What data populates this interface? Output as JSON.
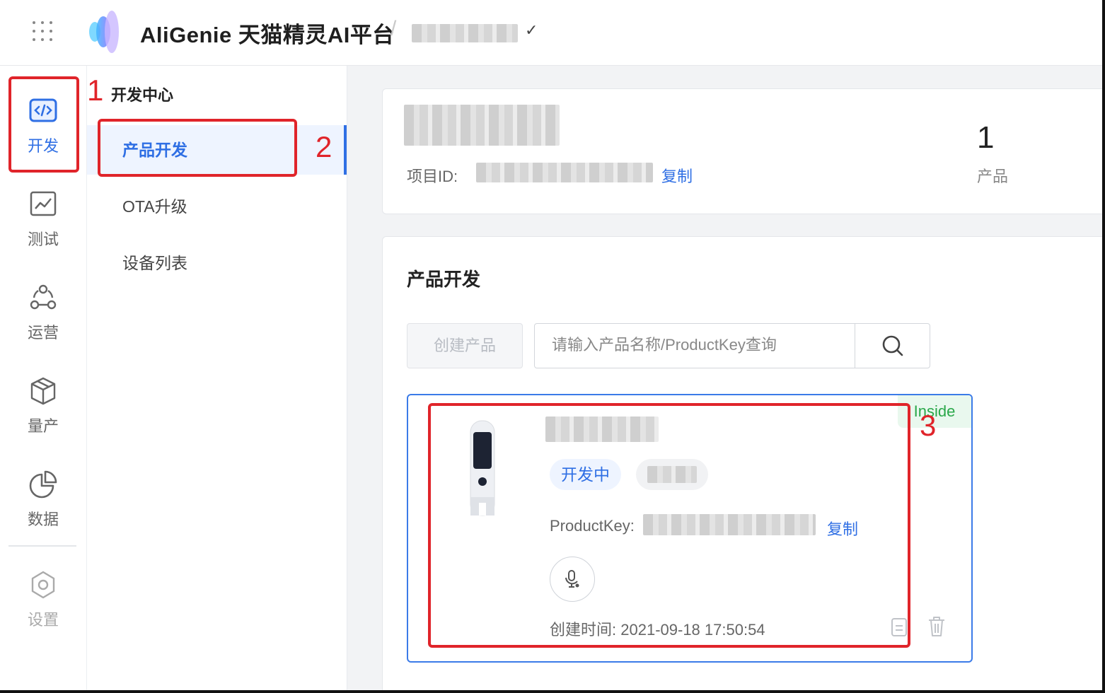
{
  "header": {
    "brand": "AliGenie 天猫精灵AI平台",
    "separator": "/",
    "project_select_chevron": "✓"
  },
  "rail": {
    "items": [
      {
        "label": "开发",
        "icon": "code-icon"
      },
      {
        "label": "测试",
        "icon": "chart-icon"
      },
      {
        "label": "运营",
        "icon": "network-icon"
      },
      {
        "label": "量产",
        "icon": "cube-icon"
      },
      {
        "label": "数据",
        "icon": "pie-icon"
      },
      {
        "label": "设置",
        "icon": "gear-icon"
      }
    ]
  },
  "subnav": {
    "title": "开发中心",
    "items": [
      {
        "label": "产品开发"
      },
      {
        "label": "OTA升级"
      },
      {
        "label": "设备列表"
      }
    ]
  },
  "project": {
    "id_label": "项目ID:",
    "copy_label": "复制",
    "product_count": "1",
    "product_count_label": "产品"
  },
  "products": {
    "title": "产品开发",
    "create_button": "创建产品",
    "search_placeholder": "请输入产品名称/ProductKey查询",
    "card": {
      "inside_tag": "Inside",
      "status_tag": "开发中",
      "productkey_label": "ProductKey:",
      "copy_label": "复制",
      "created_label": "创建时间:",
      "created_value": "2021-09-18 17:50:54"
    }
  },
  "annotations": [
    "1",
    "2",
    "3"
  ],
  "colors": {
    "accent": "#2f6fe4",
    "annotation": "#e0242a",
    "inside_green": "#2aa84a"
  }
}
